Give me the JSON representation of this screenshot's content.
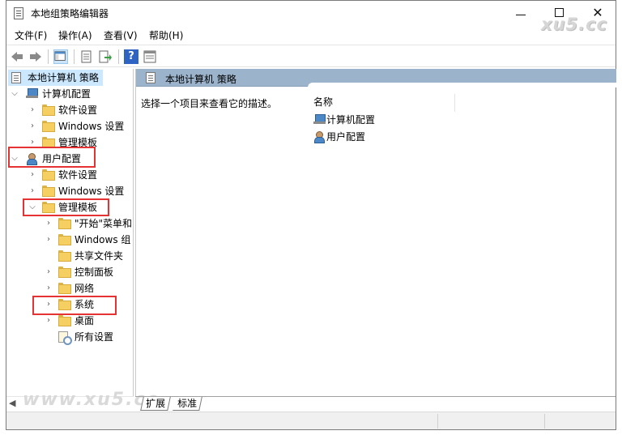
{
  "window": {
    "title": "本地组策略编辑器",
    "minimize_glyph": "",
    "close_glyph": "✕"
  },
  "watermarks": {
    "top": "xu5.cc",
    "bottom": "www.xu5.cc"
  },
  "menu": [
    {
      "label": "文件(F)"
    },
    {
      "label": "操作(A)"
    },
    {
      "label": "查看(V)"
    },
    {
      "label": "帮助(H)"
    }
  ],
  "toolbar": {
    "help_glyph": "?",
    "icons": [
      "back-arrow-icon",
      "forward-arrow-icon",
      "show-tree-icon",
      "properties-icon",
      "export-icon",
      "help-icon",
      "filter-view-icon"
    ]
  },
  "tree": {
    "root": "本地计算机 策略",
    "computer_config": "计算机配置",
    "cc_software": "软件设置",
    "cc_windows": "Windows 设置",
    "cc_admin": "管理模板",
    "user_config": "用户配置",
    "uc_software": "软件设置",
    "uc_windows": "Windows 设置",
    "uc_admin": "管理模板",
    "uc_admin_start": "\"开始\"菜单和",
    "uc_admin_windows": "Windows 组",
    "uc_admin_shared": "共享文件夹",
    "uc_admin_control": "控制面板",
    "uc_admin_network": "网络",
    "uc_admin_system": "系统",
    "uc_admin_desktop": "桌面",
    "uc_admin_all": "所有设置"
  },
  "right_pane": {
    "header": "本地计算机 策略",
    "description": "选择一个项目来查看它的描述。",
    "column_name": "名称",
    "items": [
      "计算机配置",
      "用户配置"
    ]
  },
  "tabs": {
    "extended": "扩展",
    "standard": "标准"
  },
  "colors": {
    "highlight_box": "#e53333",
    "header_bar": "#9bb3cb",
    "selection": "#cce8ff"
  }
}
